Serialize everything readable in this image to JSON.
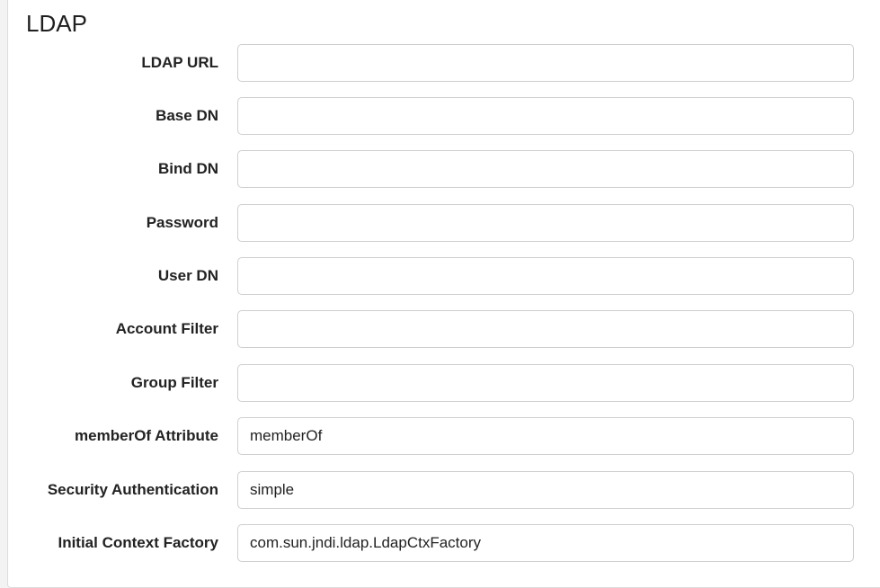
{
  "section": {
    "title": "LDAP"
  },
  "fields": [
    {
      "label": "LDAP URL",
      "value": ""
    },
    {
      "label": "Base DN",
      "value": ""
    },
    {
      "label": "Bind DN",
      "value": ""
    },
    {
      "label": "Password",
      "value": ""
    },
    {
      "label": "User DN",
      "value": ""
    },
    {
      "label": "Account Filter",
      "value": ""
    },
    {
      "label": "Group Filter",
      "value": ""
    },
    {
      "label": "memberOf Attribute",
      "value": "memberOf"
    },
    {
      "label": "Security Authentication",
      "value": "simple"
    },
    {
      "label": "Initial Context Factory",
      "value": "com.sun.jndi.ldap.LdapCtxFactory"
    }
  ]
}
